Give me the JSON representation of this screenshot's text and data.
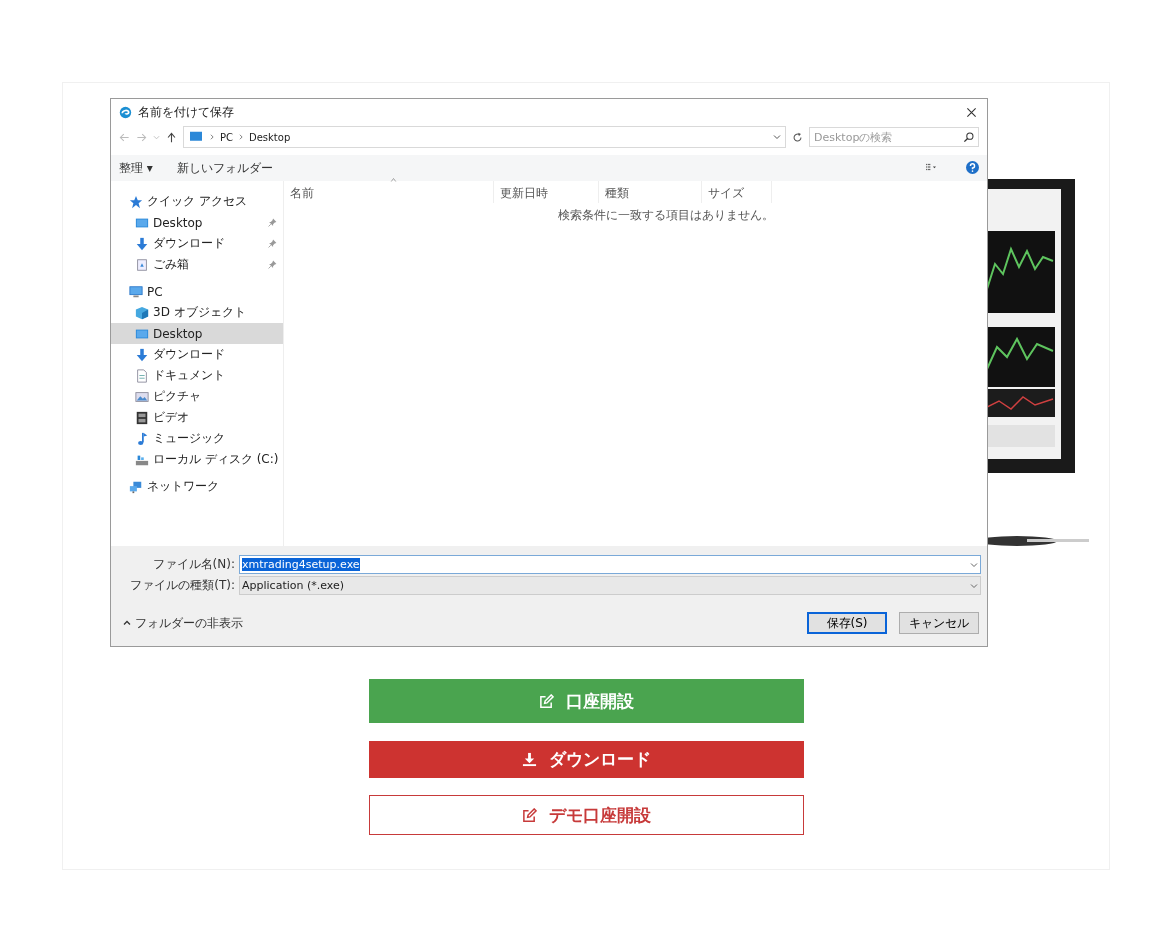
{
  "dialog": {
    "title": "名前を付けて保存",
    "address": {
      "crumbs": [
        "PC",
        "Desktop"
      ],
      "search_placeholder": "Desktopの検索"
    },
    "toolbar": {
      "organize": "整理 ▾",
      "new_folder": "新しいフォルダー"
    },
    "sidebar": {
      "items": [
        {
          "label": "クイック アクセス",
          "kind": "star",
          "selected": false,
          "children": [
            {
              "label": "Desktop",
              "kind": "desktop",
              "pinned": true,
              "selected": false
            },
            {
              "label": "ダウンロード",
              "kind": "download",
              "pinned": true,
              "selected": false
            },
            {
              "label": "ごみ箱",
              "kind": "trash",
              "pinned": true,
              "selected": false
            }
          ]
        },
        {
          "label": "PC",
          "kind": "pc",
          "selected": false,
          "children": [
            {
              "label": "3D オブジェクト",
              "kind": "cube",
              "selected": false
            },
            {
              "label": "Desktop",
              "kind": "desktop",
              "selected": true
            },
            {
              "label": "ダウンロード",
              "kind": "download",
              "selected": false
            },
            {
              "label": "ドキュメント",
              "kind": "document",
              "selected": false
            },
            {
              "label": "ピクチャ",
              "kind": "picture",
              "selected": false
            },
            {
              "label": "ビデオ",
              "kind": "video",
              "selected": false
            },
            {
              "label": "ミュージック",
              "kind": "music",
              "selected": false
            },
            {
              "label": "ローカル ディスク (C:)",
              "kind": "drive",
              "selected": false
            }
          ]
        },
        {
          "label": "ネットワーク",
          "kind": "network",
          "selected": false
        }
      ]
    },
    "table": {
      "columns": [
        {
          "label": "名前",
          "sorted": true
        },
        {
          "label": "更新日時",
          "sorted": false
        },
        {
          "label": "種類",
          "sorted": false
        },
        {
          "label": "サイズ",
          "sorted": false
        }
      ],
      "empty_message": "検索条件に一致する項目はありません。"
    },
    "file_name": {
      "label": "ファイル名(N):",
      "value": "xmtrading4setup.exe",
      "selected": true
    },
    "file_type": {
      "label": "ファイルの種類(T):",
      "value": "Application (*.exe)"
    },
    "hide_folders": "フォルダーの非表示",
    "buttons": [
      {
        "label": "保存(S)",
        "default": true
      },
      {
        "label": "キャンセル",
        "default": false
      }
    ]
  },
  "actions": [
    {
      "label": "口座開設",
      "kind": "green"
    },
    {
      "label": "ダウンロード",
      "kind": "red"
    },
    {
      "label": "デモ口座開設",
      "kind": "outline"
    }
  ]
}
